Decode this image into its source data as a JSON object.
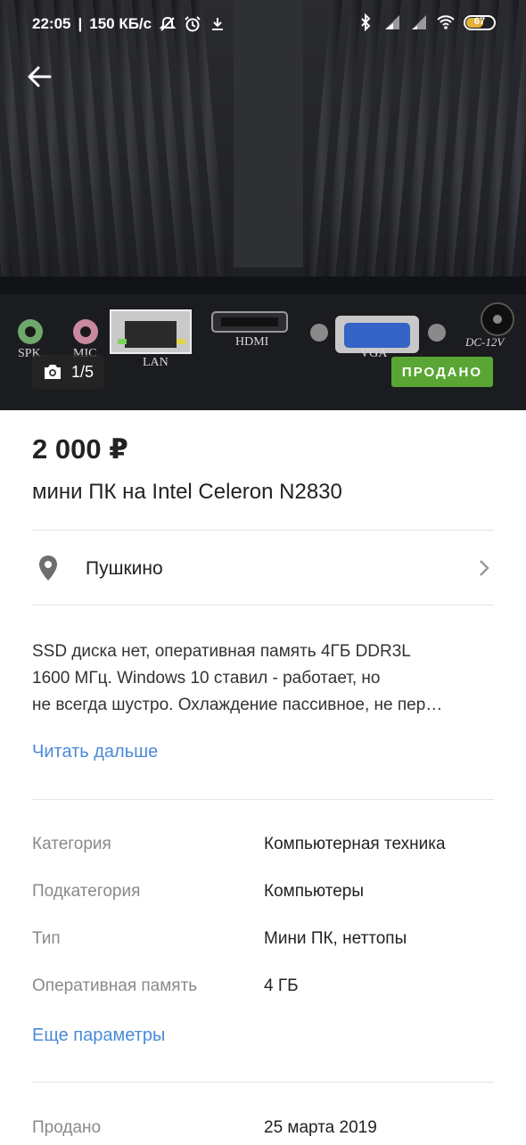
{
  "status_bar": {
    "time": "22:05",
    "speed": "150 КБ/с",
    "battery": "67"
  },
  "gallery": {
    "counter": "1/5",
    "badge": "ПРОДАНО",
    "port_labels": [
      "SPK",
      "MIC",
      "LAN",
      "HDMI",
      "VGA",
      "DC-12V"
    ]
  },
  "listing": {
    "price": "2 000 ₽",
    "title": "мини ПК на Intel Celeron N2830",
    "location": "Пушкино",
    "description_lines": [
      "SSD диска нет, оперативная память 4ГБ DDR3L",
      "1600 МГц. Windows 10 ставил - работает, но",
      "не всегда шустро. Охлаждение пассивное, не пер…"
    ],
    "read_more": "Читать дальше"
  },
  "params": [
    {
      "key": "Категория",
      "value": "Компьютерная техника"
    },
    {
      "key": "Подкатегория",
      "value": "Компьютеры"
    },
    {
      "key": "Тип",
      "value": "Мини ПК, неттопы"
    },
    {
      "key": "Оперативная память",
      "value": "4 ГБ"
    }
  ],
  "more_params": "Еще параметры",
  "sold": {
    "key": "Продано",
    "value": "25 марта 2019"
  },
  "colors": {
    "accent_link": "#4a8ad8",
    "sold_badge": "#5aa635"
  }
}
